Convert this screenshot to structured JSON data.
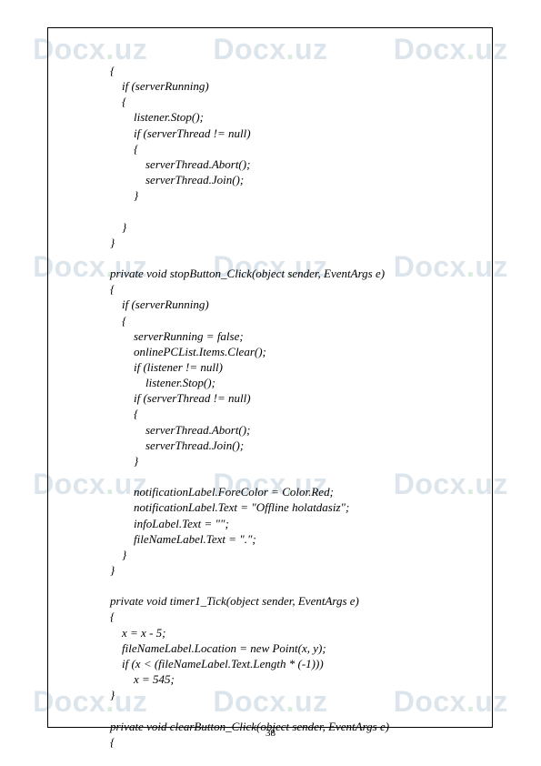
{
  "watermark": {
    "brand_prefix": "Docx",
    "brand_dot": ".",
    "brand_suffix": "uz"
  },
  "page_number": "38",
  "code_lines": [
    "        {",
    "            if (serverRunning)",
    "            {",
    "                listener.Stop();",
    "                if (serverThread != null)",
    "                {",
    "                    serverThread.Abort();",
    "                    serverThread.Join();",
    "                }",
    "",
    "            }",
    "        }",
    "",
    "        private void stopButton_Click(object sender, EventArgs e)",
    "        {",
    "            if (serverRunning)",
    "            {",
    "                serverRunning = false;",
    "                onlinePCList.Items.Clear();",
    "                if (listener != null)",
    "                    listener.Stop();",
    "                if (serverThread != null)",
    "                {",
    "                    serverThread.Abort();",
    "                    serverThread.Join();",
    "                }",
    "",
    "                notificationLabel.ForeColor = Color.Red;",
    "                notificationLabel.Text = \"Offline holatdasiz\";",
    "                infoLabel.Text = \"\";",
    "                fileNameLabel.Text = \".\";",
    "            }",
    "        }",
    "",
    "        private void timer1_Tick(object sender, EventArgs e)",
    "        {",
    "            x = x - 5;",
    "            fileNameLabel.Location = new Point(x, y);",
    "            if (x < (fileNameLabel.Text.Length * (-1)))",
    "                x = 545;",
    "        }",
    "",
    "        private void clearButton_Click(object sender, EventArgs e)",
    "        {"
  ]
}
